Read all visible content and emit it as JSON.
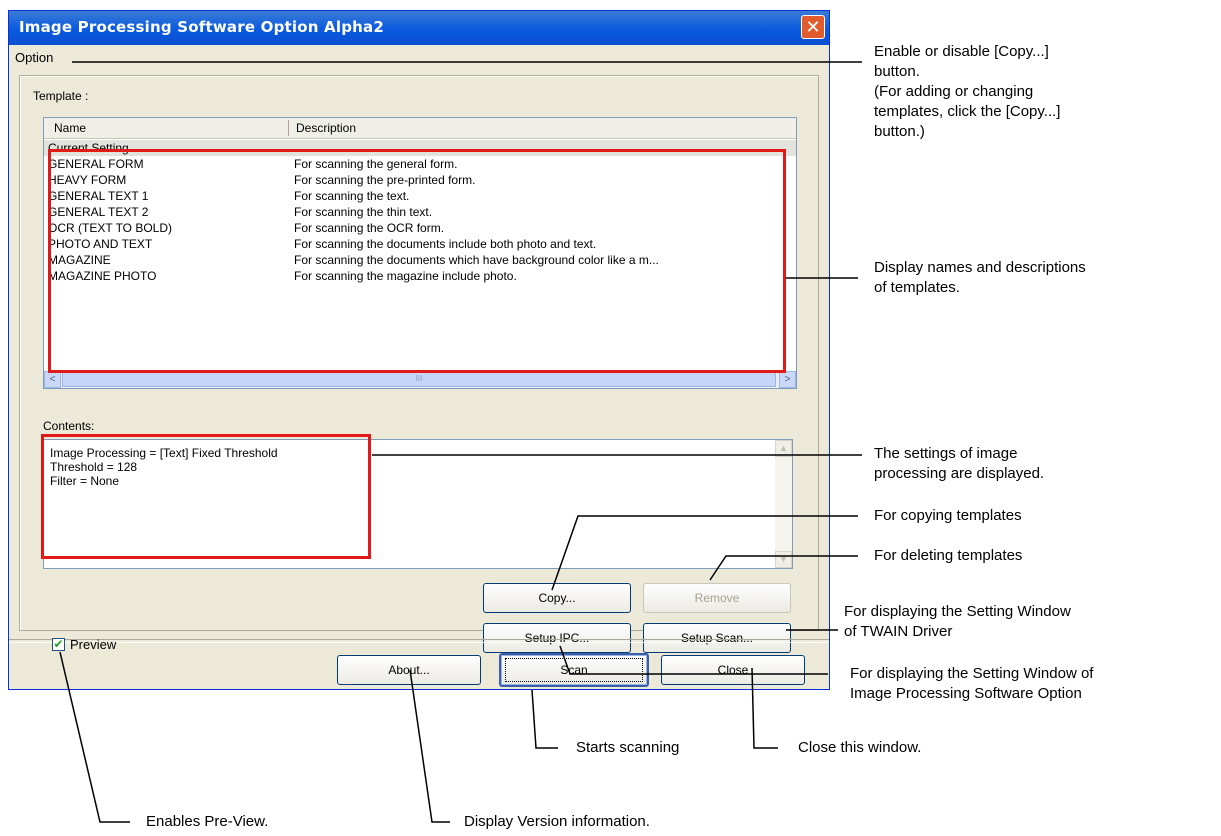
{
  "window": {
    "title": "Image Processing Software Option  Alpha2",
    "close_glyph": "✕",
    "menu_option": "Option"
  },
  "template": {
    "label": "Template :",
    "columns": [
      "Name",
      "Description"
    ],
    "rows": [
      {
        "name": "Current Setting",
        "description": ""
      },
      {
        "name": "GENERAL FORM",
        "description": "For scanning the general form."
      },
      {
        "name": "HEAVY FORM",
        "description": "For scanning the pre-printed form."
      },
      {
        "name": "GENERAL TEXT 1",
        "description": "For scanning the text."
      },
      {
        "name": "GENERAL TEXT 2",
        "description": "For scanning the thin text."
      },
      {
        "name": "OCR (TEXT TO BOLD)",
        "description": "For scanning the OCR form."
      },
      {
        "name": "PHOTO AND TEXT",
        "description": "For scanning the documents include both photo and text."
      },
      {
        "name": "MAGAZINE",
        "description": "For scanning the documents which have background color like a m..."
      },
      {
        "name": "MAGAZINE PHOTO",
        "description": "For scanning the magazine include photo."
      }
    ],
    "scroll_left_glyph": "<",
    "scroll_right_glyph": ">",
    "scroll_thumb_glyph": "III"
  },
  "contents": {
    "label": "Contents:",
    "lines": [
      "Image Processing = [Text] Fixed Threshold",
      "Threshold = 128",
      "Filter = None"
    ]
  },
  "buttons": {
    "copy": "Copy...",
    "remove": "Remove",
    "setup_ipc": "Setup IPC...",
    "setup_scan": "Setup Scan...",
    "about": "About...",
    "scan": "Scan",
    "close": "Close"
  },
  "preview": {
    "label": "Preview",
    "checked": true,
    "check_glyph": "✔"
  },
  "callouts": {
    "option": [
      "Enable or disable [Copy...]",
      "button.",
      "(For adding or changing",
      "templates, click the [Copy...]",
      "button.)"
    ],
    "templates": [
      "Display names and descriptions",
      "of templates."
    ],
    "settings": [
      "The settings of image",
      "processing are displayed."
    ],
    "copy": "For copying templates",
    "delete": "For deleting templates",
    "twain": [
      "For displaying the Setting Window",
      "of TWAIN Driver"
    ],
    "ipc": [
      "For displaying the Setting Window of",
      "Image Processing Software Option"
    ],
    "scan": "Starts scanning",
    "close": "Close this window.",
    "preview": "Enables Pre-View.",
    "about": "Display Version information."
  }
}
